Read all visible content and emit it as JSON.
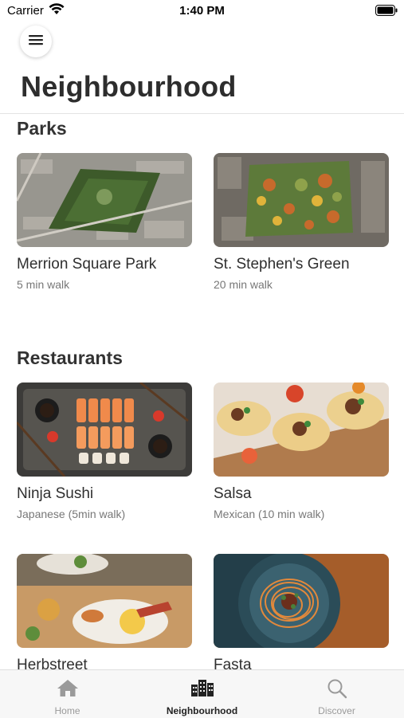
{
  "status_bar": {
    "carrier": "Carrier",
    "time": "1:40 PM"
  },
  "header": {
    "title": "Neighbourhood"
  },
  "sections": {
    "parks": {
      "title": "Parks",
      "items": [
        {
          "name": "Merrion Square Park",
          "meta": "5 min walk"
        },
        {
          "name": "St. Stephen's Green",
          "meta": "20 min walk"
        }
      ]
    },
    "restaurants": {
      "title": "Restaurants",
      "items": [
        {
          "name": "Ninja Sushi",
          "meta": "Japanese (5min walk)"
        },
        {
          "name": "Salsa",
          "meta": "Mexican (10 min walk)"
        },
        {
          "name": "Herbstreet",
          "meta": ""
        },
        {
          "name": "Fasta",
          "meta": ""
        }
      ]
    }
  },
  "tab_bar": {
    "tabs": [
      {
        "label": "Home",
        "icon": "home-icon"
      },
      {
        "label": "Neighbourhood",
        "icon": "city-icon"
      },
      {
        "label": "Discover",
        "icon": "search-icon"
      }
    ],
    "active": "Neighbourhood"
  },
  "colors": {
    "accent": "#222222",
    "inactive": "#9a9a9a"
  }
}
